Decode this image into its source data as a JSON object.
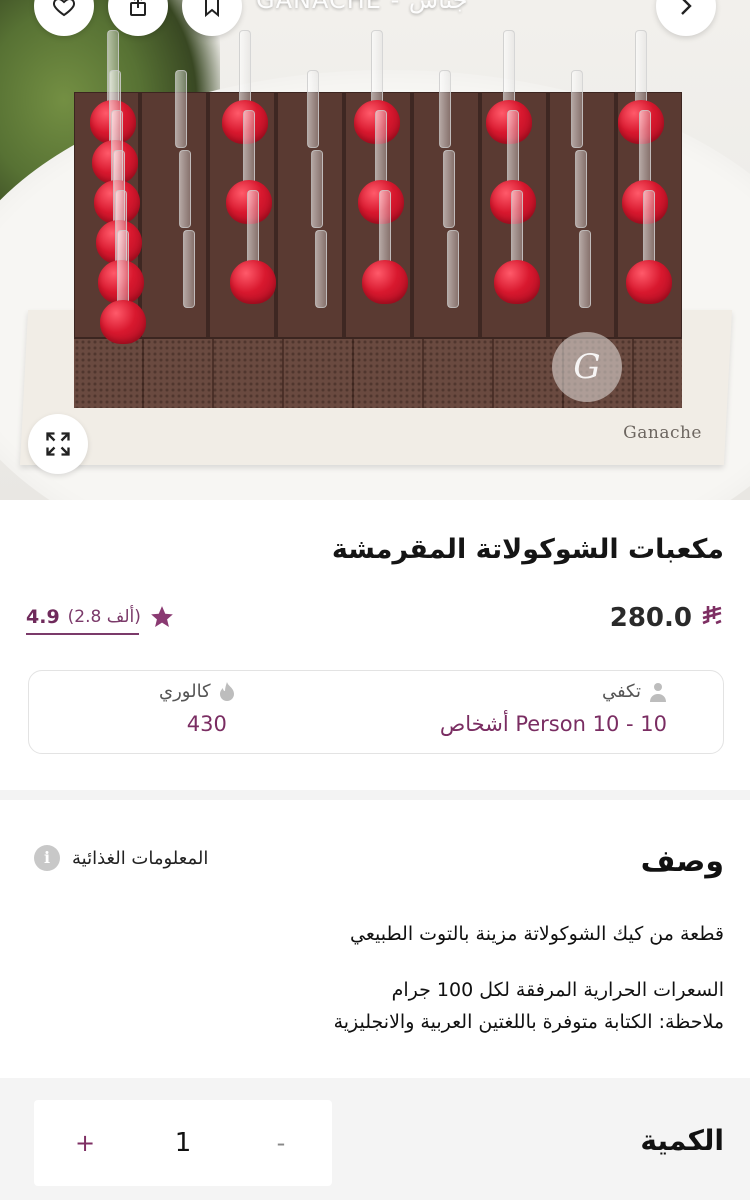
{
  "header": {
    "brand_title": "GANACHE - جناش",
    "icons": [
      "heart-icon",
      "share-icon",
      "bookmark-icon",
      "back-arrow-icon"
    ]
  },
  "hero": {
    "board_brand": "Ganache",
    "logo_letter": "G"
  },
  "product": {
    "name": "مكعبات الشوكولاتة المقرمشة",
    "price": "280.0",
    "currency_symbol": "⃁",
    "rating": "4.9",
    "rating_count": "(2.8 ألف)"
  },
  "facts": {
    "serves_label": "تكفي",
    "serves_value": "10 - 10 Person أشخاص",
    "calories_label": "كالوري",
    "calories_value": "430"
  },
  "description": {
    "title": "وصف",
    "nutrition_label": "المعلومات الغذائية",
    "line1": "قطعة من كيك الشوكولاتة مزينة بالتوت الطبيعي",
    "line2": "السعرات الحرارية المرفقة لكل 100 جرام",
    "line3": "ملاحظة: الكتابة متوفرة باللغتين العربية والانجليزية"
  },
  "quantity": {
    "label": "الكمية",
    "value": "1",
    "plus": "+",
    "minus": "-"
  },
  "colors": {
    "accent": "#7e2f63",
    "rating": "#6f2a5b",
    "separator": "#f3f3f3"
  }
}
